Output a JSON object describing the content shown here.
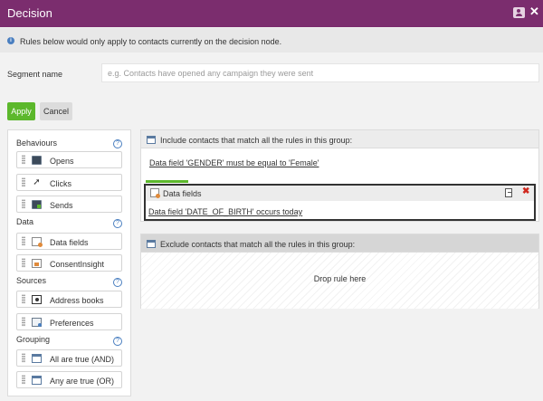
{
  "window": {
    "title": "Decision"
  },
  "info": {
    "text": "Rules below would only apply to contacts currently on the decision node."
  },
  "segment": {
    "label": "Segment name",
    "value": "",
    "placeholder": "e.g. Contacts have opened any campaign they were sent"
  },
  "actions": {
    "apply_label": "Apply",
    "cancel_label": "Cancel"
  },
  "palette": {
    "help_glyph": "?",
    "sections": {
      "behaviours": {
        "label": "Behaviours",
        "items": [
          "Opens",
          "Clicks",
          "Sends"
        ]
      },
      "data": {
        "label": "Data",
        "items": [
          "Data fields",
          "ConsentInsight"
        ]
      },
      "sources": {
        "label": "Sources",
        "items": [
          "Address books",
          "Preferences"
        ]
      },
      "grouping": {
        "label": "Grouping",
        "items": [
          "All are true (AND)",
          "Any are true (OR)"
        ]
      }
    }
  },
  "include_group": {
    "title": "Include contacts that match all the rules in this group:",
    "rule_text": "Data field 'GENDER' must be equal to 'Female'"
  },
  "selected_rule": {
    "title": "Data fields",
    "rule_text": "Data field 'DATE_OF_BIRTH' occurs today"
  },
  "exclude_group": {
    "title": "Exclude contacts that match all the rules in this group:",
    "drop_text": "Drop rule here"
  },
  "colors": {
    "brand": "#7b2d6e",
    "apply": "#5cb82c",
    "delete": "#d0281e",
    "info": "#4a7fc0"
  }
}
